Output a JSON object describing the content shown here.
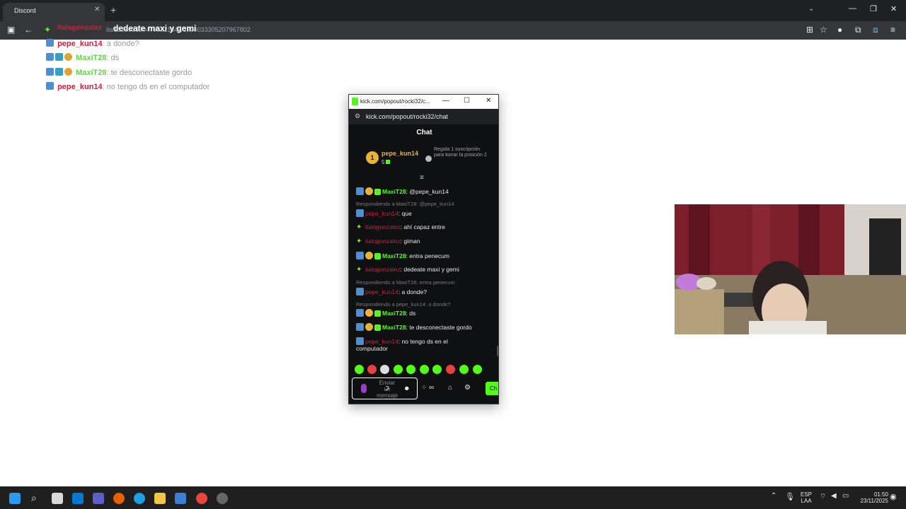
{
  "browser": {
    "tab_title": "Discord",
    "tab_close": "✕",
    "new_tab": "+",
    "url": "ils/1326033304700321842/1326033305207967802",
    "overlay_title_left": "italogonzalez",
    "overlay_title": "dedeate maxi y gemi",
    "window_buttons": [
      "—",
      "❐",
      "✕"
    ]
  },
  "background_chat": {
    "lines": [
      {
        "user": "pepe_kun14",
        "message": ": a donde?",
        "user_color": "red"
      },
      {
        "user": "MaxiT28",
        "message": ": ds",
        "user_color": "green"
      },
      {
        "user": "MaxiT28",
        "message": ": te desconectaste gordo",
        "user_color": "green"
      },
      {
        "user": "pepe_kun14",
        "message": ": no tengo ds en el computador",
        "user_color": "red"
      }
    ]
  },
  "popout": {
    "window_title": "kick.com/popout/rocki32/c...",
    "url": "kick.com/popout/rocki32/chat",
    "chat_title": "Chat",
    "top_gifter": {
      "rank": "1",
      "name": "pepe_kun14",
      "count": "5",
      "promo": "Regala 1 suscripción para tomar la posición 2"
    },
    "messages": [
      {
        "kind": "msg",
        "badges": [
          "mod",
          "sub",
          "gem"
        ],
        "user": "MaxiT28",
        "user_color": "green",
        "text": ": @pepe_kun14"
      },
      {
        "kind": "reply",
        "text": "Respondiendo a MaxiT28: @pepe_kun14"
      },
      {
        "kind": "msg",
        "badges": [
          "mod"
        ],
        "user": "pepe_kun14",
        "user_color": "red",
        "text": ": que"
      },
      {
        "kind": "msg",
        "badges": [
          "star"
        ],
        "user": "italogonzalez",
        "user_color": "red",
        "text": ": ahí capaz entre"
      },
      {
        "kind": "msg",
        "badges": [
          "star"
        ],
        "user": "italogonzalez",
        "user_color": "red",
        "text": ": giman"
      },
      {
        "kind": "msg",
        "badges": [
          "mod",
          "sub",
          "gem"
        ],
        "user": "MaxiT28",
        "user_color": "green",
        "text": ": entra penecum"
      },
      {
        "kind": "msg",
        "badges": [
          "star"
        ],
        "user": "italogonzalez",
        "user_color": "red",
        "text": ": dedeate maxi y gemi"
      },
      {
        "kind": "reply",
        "text": "Respondiendo a MaxiT28: entra penecum"
      },
      {
        "kind": "msg",
        "badges": [
          "mod"
        ],
        "user": "pepe_kun14",
        "user_color": "red",
        "text": ": a donde?"
      },
      {
        "kind": "reply",
        "text": "Respondiendo a pepe_kun14: a donde?"
      },
      {
        "kind": "msg",
        "badges": [
          "mod",
          "sub",
          "gem"
        ],
        "user": "MaxiT28",
        "user_color": "green",
        "text": ": ds"
      },
      {
        "kind": "msg",
        "badges": [
          "mod",
          "sub",
          "gem"
        ],
        "user": "MaxiT28",
        "user_color": "green",
        "text": ": te desconectaste gordo"
      },
      {
        "kind": "msg",
        "badges": [
          "mod"
        ],
        "user": "pepe_kun14",
        "user_color": "red",
        "text": ": no tengo ds en el",
        "continuation": "computador"
      }
    ],
    "input_placeholder": "Enviar un mensaje",
    "send_label": "Ch"
  },
  "taskbar": {
    "language": "ESP",
    "layout": "LAA",
    "time": "01:50",
    "date": "23/11/2025"
  },
  "colors": {
    "kick_green": "#53fc18",
    "red_user": "#d21e3c",
    "gold": "#e8b33a"
  }
}
